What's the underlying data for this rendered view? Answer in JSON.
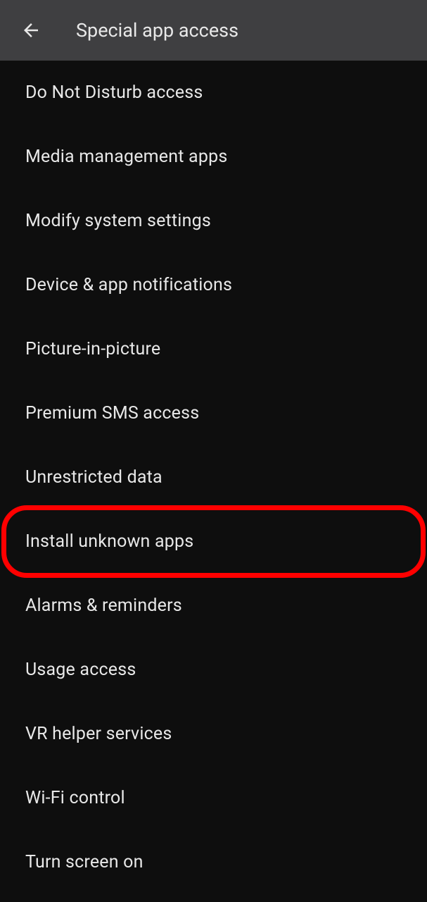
{
  "header": {
    "title": "Special app access"
  },
  "items": [
    {
      "label": "Do Not Disturb access",
      "highlighted": false
    },
    {
      "label": "Media management apps",
      "highlighted": false
    },
    {
      "label": "Modify system settings",
      "highlighted": false
    },
    {
      "label": "Device & app notifications",
      "highlighted": false
    },
    {
      "label": "Picture-in-picture",
      "highlighted": false
    },
    {
      "label": "Premium SMS access",
      "highlighted": false
    },
    {
      "label": "Unrestricted data",
      "highlighted": false
    },
    {
      "label": "Install unknown apps",
      "highlighted": true
    },
    {
      "label": "Alarms & reminders",
      "highlighted": false
    },
    {
      "label": "Usage access",
      "highlighted": false
    },
    {
      "label": "VR helper services",
      "highlighted": false
    },
    {
      "label": "Wi-Fi control",
      "highlighted": false
    },
    {
      "label": "Turn screen on",
      "highlighted": false
    }
  ]
}
